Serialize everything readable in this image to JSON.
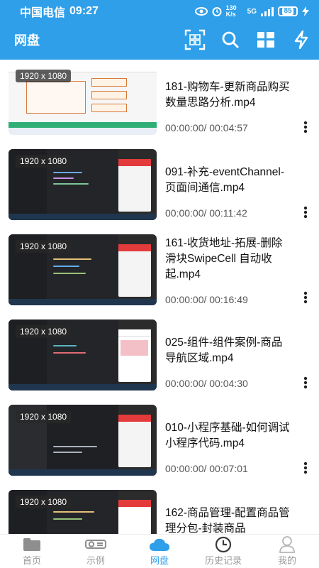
{
  "status": {
    "carrier": "中国电信",
    "time": "09:27",
    "net_speed": "130 K/s",
    "network": "5G",
    "battery": "85"
  },
  "appbar": {
    "title": "网盘",
    "icons": [
      "scan-icon",
      "search-icon",
      "grid-icon",
      "flash-icon"
    ]
  },
  "videos": [
    {
      "resolution": "1920 x 1080",
      "name": "181-购物车-更新商品购买数量思路分析.mp4",
      "duration": "00:00:00/ 00:04:57"
    },
    {
      "resolution": "1920 x 1080",
      "name": "091-补充-eventChannel-页面间通信.mp4",
      "duration": "00:00:00/ 00:11:42"
    },
    {
      "resolution": "1920 x 1080",
      "name": "161-收货地址-拓展-删除滑块SwipeCell 自动收起.mp4",
      "duration": "00:00:00/ 00:16:49"
    },
    {
      "resolution": "1920 x 1080",
      "name": "025-组件-组件案例-商品导航区域.mp4",
      "duration": "00:00:00/ 00:04:30"
    },
    {
      "resolution": "1920 x 1080",
      "name": "010-小程序基础-如何调试小程序代码.mp4",
      "duration": "00:00:00/ 00:07:01"
    },
    {
      "resolution": "1920 x 1080",
      "name": "162-商品管理-配置商品管理分包-封装商品",
      "duration": ""
    }
  ],
  "tabs": [
    {
      "label": "首页",
      "icon": "folder-icon"
    },
    {
      "label": "示例",
      "icon": "projector-icon"
    },
    {
      "label": "网盘",
      "icon": "cloud-icon",
      "active": true
    },
    {
      "label": "历史记录",
      "icon": "clock-icon"
    },
    {
      "label": "我的",
      "icon": "person-icon"
    }
  ],
  "colors": {
    "primary": "#2f9fe9",
    "text": "#111111",
    "muted": "#555555",
    "tab_inactive": "#9a9a9a"
  }
}
